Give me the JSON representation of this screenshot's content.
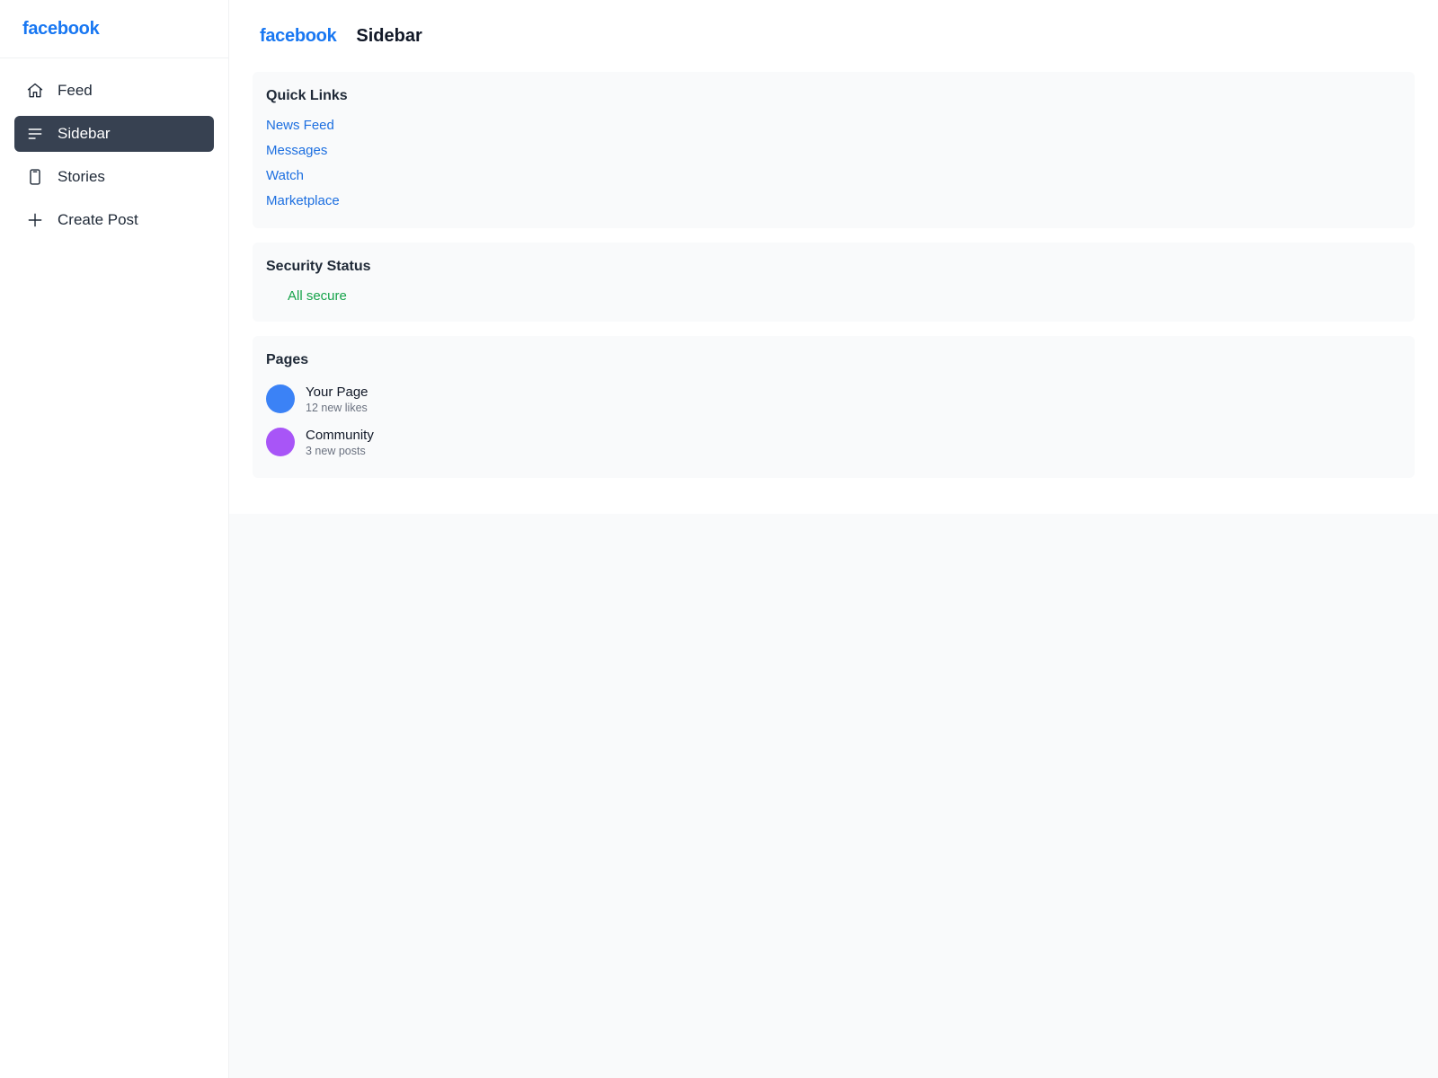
{
  "sidebar": {
    "brand": "facebook",
    "items": [
      {
        "label": "Feed",
        "icon": "home-icon",
        "active": false
      },
      {
        "label": "Sidebar",
        "icon": "menu-lines-icon",
        "active": true
      },
      {
        "label": "Stories",
        "icon": "phone-icon",
        "active": false
      },
      {
        "label": "Create Post",
        "icon": "plus-icon",
        "active": false
      }
    ]
  },
  "header": {
    "brand": "facebook",
    "title": "Sidebar"
  },
  "quick_links": {
    "title": "Quick Links",
    "links": [
      "News Feed",
      "Messages",
      "Watch",
      "Marketplace"
    ]
  },
  "security": {
    "title": "Security Status",
    "status": "All secure",
    "status_color": "#16a34a"
  },
  "pages": {
    "title": "Pages",
    "items": [
      {
        "name": "Your Page",
        "meta": "12 new likes",
        "color": "#3b82f6"
      },
      {
        "name": "Community",
        "meta": "3 new posts",
        "color": "#a855f7"
      }
    ]
  },
  "colors": {
    "brand": "#1877f2",
    "active_nav": "#374151",
    "link": "#1d6fe0"
  }
}
